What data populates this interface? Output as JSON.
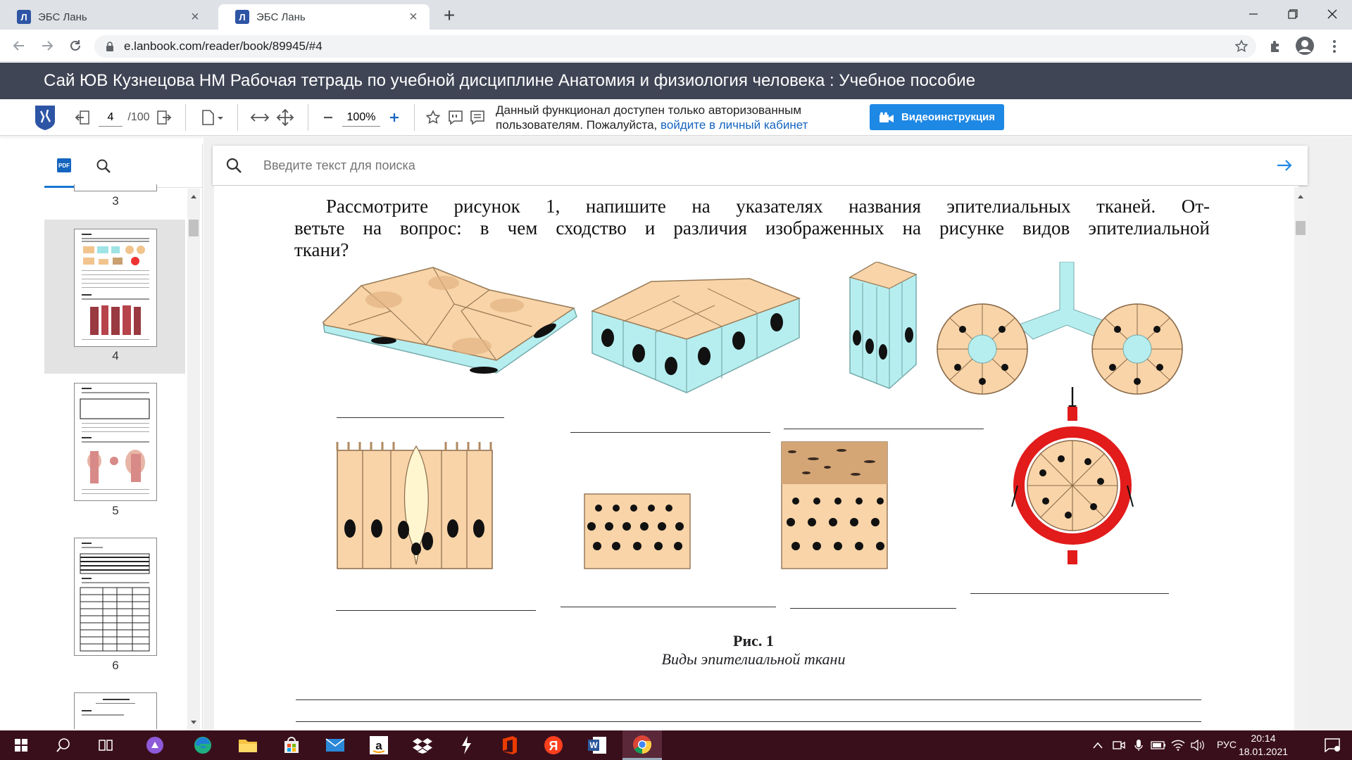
{
  "browser": {
    "tabs": [
      {
        "title": "ЭБС Лань",
        "active": false
      },
      {
        "title": "ЭБС Лань",
        "active": true
      }
    ],
    "url": "e.lanbook.com/reader/book/89945/#4"
  },
  "site": {
    "title": "Сай ЮВ Кузнецова НМ Рабочая тетрадь по учебной дисциплине Анатомия и физиология человека : Учебное пособие"
  },
  "reader": {
    "current_page": "4",
    "total_pages": "/100",
    "zoom": "100%",
    "notice_line1": "Данный функционал доступен только авторизованным",
    "notice_line2_prefix": "пользователям. Пожалуйста,",
    "notice_link": "войдите в личный кабинет",
    "video_button": "Видеоинструкция",
    "search_placeholder": "Введите текст для поиска"
  },
  "sidebar": {
    "thumbnails": [
      {
        "page": "3"
      },
      {
        "page": "4",
        "selected": true
      },
      {
        "page": "5"
      },
      {
        "page": "6"
      }
    ]
  },
  "document": {
    "paragraph_line1": "Рассмотрите рисунок 1, напишите на указателях названия эпителиальных тканей. От-",
    "paragraph_line2": "ветьте на вопрос: в чем сходство и различия изображенных на рисунке видов эпителиальной",
    "paragraph_line3": "ткани?",
    "figure_caption_title": "Рис. 1",
    "figure_caption_subtitle": "Виды эпителиальной ткани"
  },
  "taskbar": {
    "language": "РУС",
    "time": "20:14",
    "date": "18.01.2021"
  },
  "colors": {
    "site_header_bg": "#3f4555",
    "tissue_tan": "#f8d4a8",
    "tissue_cyan": "#b6eef0",
    "blood_red": "#e21b1b",
    "taskbar_bg": "#3a0f1c",
    "accent_blue": "#1e88e5"
  }
}
